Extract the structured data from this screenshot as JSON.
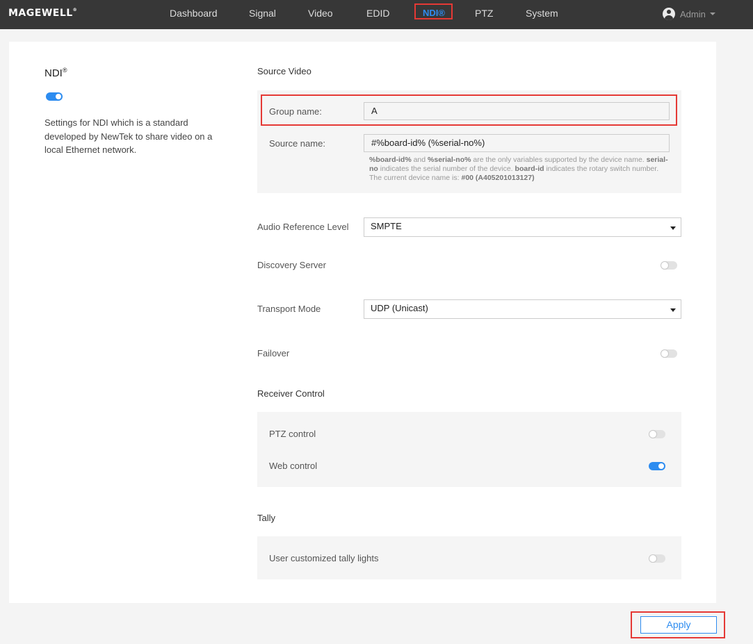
{
  "brand": {
    "name": "MAGEWELL",
    "mark": "®"
  },
  "nav": {
    "items": [
      {
        "label": "Dashboard"
      },
      {
        "label": "Signal"
      },
      {
        "label": "Video"
      },
      {
        "label": "EDID"
      },
      {
        "label": "NDI®"
      },
      {
        "label": "PTZ"
      },
      {
        "label": "System"
      }
    ],
    "active_index": 4,
    "user": "Admin"
  },
  "sidebar": {
    "title": "NDI",
    "title_mark": "®",
    "ndi_enabled": true,
    "description": "Settings for NDI which is a standard developed by NewTek to share video on a local Ethernet network."
  },
  "source_video": {
    "title": "Source Video",
    "group_name_label": "Group name:",
    "group_name_value": "A",
    "source_name_label": "Source name:",
    "source_name_value": "#%board-id% (%serial-no%)",
    "hint": {
      "var1": "%board-id%",
      "and": " and ",
      "var2": "%serial-no%",
      "text1": " are the only variables supported by the device name. ",
      "serial": "serial-no",
      "text2": " indicates the serial number of the device. ",
      "board": "board-id",
      "text3": " indicates the rotary switch number. The current device name is: ",
      "device": "#00 (A405201013127)"
    }
  },
  "audio_reference_level": {
    "label": "Audio Reference Level",
    "value": "SMPTE"
  },
  "discovery_server": {
    "label": "Discovery Server",
    "enabled": false
  },
  "transport_mode": {
    "label": "Transport Mode",
    "value": "UDP (Unicast)"
  },
  "failover": {
    "label": "Failover",
    "enabled": false
  },
  "receiver_control": {
    "title": "Receiver Control",
    "ptz_label": "PTZ control",
    "ptz_enabled": false,
    "web_label": "Web control",
    "web_enabled": true
  },
  "tally": {
    "title": "Tally",
    "custom_label": "User customized tally lights",
    "custom_enabled": false
  },
  "apply_label": "Apply",
  "colors": {
    "accent": "#2d8cf0",
    "highlight": "#e53935",
    "topbar": "#373737"
  }
}
